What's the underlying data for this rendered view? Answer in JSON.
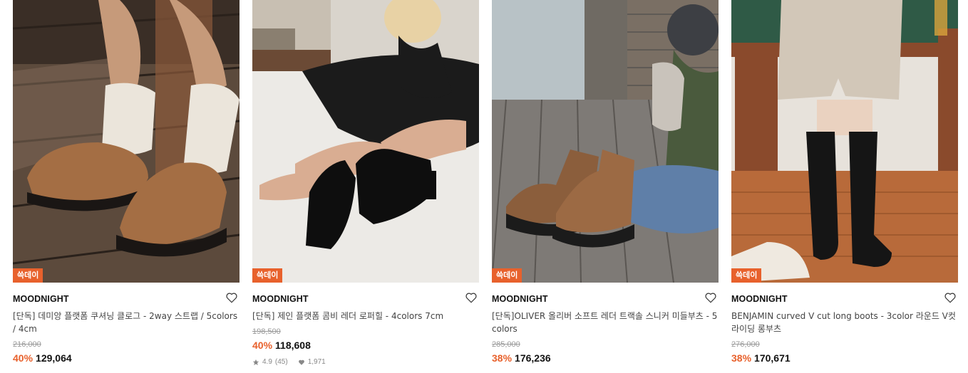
{
  "products": [
    {
      "badge": "쓱데이",
      "brand": "MOODNIGHT",
      "title": "[단독] 데미앙 플랫폼 쿠셔닝 클로그 - 2way 스트랩 / 5colors / 4cm",
      "original_price": "216,000",
      "discount": "40%",
      "price": "129,064",
      "image_icon": "clog-shoes-photo"
    },
    {
      "badge": "쓱데이",
      "brand": "MOODNIGHT",
      "title": "[단독] 제인 플랫폼 콤비 레더 로퍼힐 - 4colors 7cm",
      "original_price": "198,500",
      "discount": "40%",
      "price": "118,608",
      "rating": "4.9",
      "review_count": "(45)",
      "likes": "1,971",
      "image_icon": "loafer-heels-photo"
    },
    {
      "badge": "쓱데이",
      "brand": "MOODNIGHT",
      "title": "[단독]OLIVER 올리버 소프트 레더 트랙솔 스니커 미들부츠 - 5colors",
      "original_price": "285,000",
      "discount": "38%",
      "price": "176,236",
      "image_icon": "middle-boots-photo"
    },
    {
      "badge": "쓱데이",
      "brand": "MOODNIGHT",
      "title": "BENJAMIN curved V cut long boots - 3color 라운드 V컷 라이딩 롱부츠",
      "original_price": "276,000",
      "discount": "38%",
      "price": "170,671",
      "image_icon": "long-boots-photo"
    }
  ],
  "colors": {
    "accent": "#e8612c",
    "brand_text": "#111111",
    "muted": "#999999"
  }
}
